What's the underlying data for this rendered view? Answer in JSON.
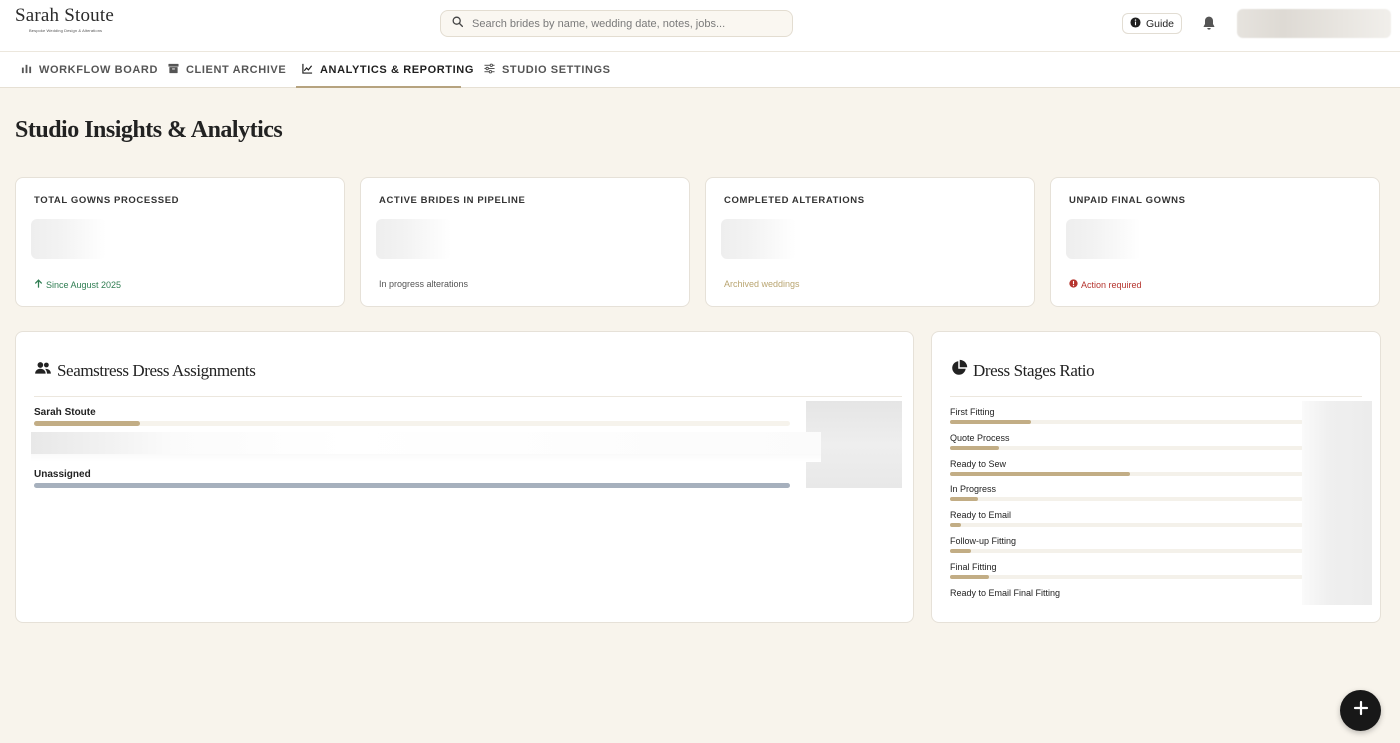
{
  "brand": {
    "name": "Sarah Stoute",
    "tagline": "Bespoke Wedding Design & Alterations"
  },
  "search": {
    "placeholder": "Search brides by name, wedding date, notes, jobs..."
  },
  "header": {
    "guide_label": "Guide"
  },
  "nav": {
    "tabs": [
      {
        "label": "WORKFLOW BOARD",
        "icon": "bar-chart-icon",
        "active": false
      },
      {
        "label": "CLIENT ARCHIVE",
        "icon": "archive-box-icon",
        "active": false
      },
      {
        "label": "ANALYTICS & REPORTING",
        "icon": "line-chart-icon",
        "active": true
      },
      {
        "label": "STUDIO SETTINGS",
        "icon": "sliders-icon",
        "active": false
      }
    ]
  },
  "page": {
    "title": "Studio Insights & Analytics"
  },
  "stats": [
    {
      "label": "TOTAL GOWNS PROCESSED",
      "footnote": "Since August 2025",
      "footnote_icon": "arrow-up-icon",
      "footnote_color": "#2f7d52"
    },
    {
      "label": "ACTIVE BRIDES IN PIPELINE",
      "footnote": "In progress alterations",
      "footnote_color": "#555555"
    },
    {
      "label": "COMPLETED ALTERATIONS",
      "footnote": "Archived weddings",
      "footnote_color": "#b9a571"
    },
    {
      "label": "UNPAID FINAL GOWNS",
      "footnote": "Action required",
      "footnote_icon": "alert-circle-icon",
      "footnote_color": "#b5342e"
    }
  ],
  "assignments": {
    "title": "Seamstress Dress Assignments",
    "icon": "users-icon",
    "rows": [
      {
        "name": "Sarah Stoute",
        "fill": 0.14,
        "color": "#c2ad85"
      },
      {
        "name": "Unassigned",
        "fill": 1.0,
        "color": "#a6b0bd"
      }
    ]
  },
  "stages": {
    "title": "Dress Stages Ratio",
    "icon": "pie-chart-icon",
    "rows": [
      {
        "label": "First Fitting",
        "fill": 0.23
      },
      {
        "label": "Quote Process",
        "fill": 0.14
      },
      {
        "label": "Ready to Sew",
        "fill": 0.51
      },
      {
        "label": "In Progress",
        "fill": 0.08
      },
      {
        "label": "Ready to Email",
        "fill": 0.03
      },
      {
        "label": "Follow-up Fitting",
        "fill": 0.06
      },
      {
        "label": "Final Fitting",
        "fill": 0.11
      },
      {
        "label": "Ready to Email Final Fitting",
        "fill": 0.0
      }
    ]
  },
  "colors": {
    "accent": "#b6a37f",
    "background": "#f8f4ec",
    "fab": "#181818"
  }
}
